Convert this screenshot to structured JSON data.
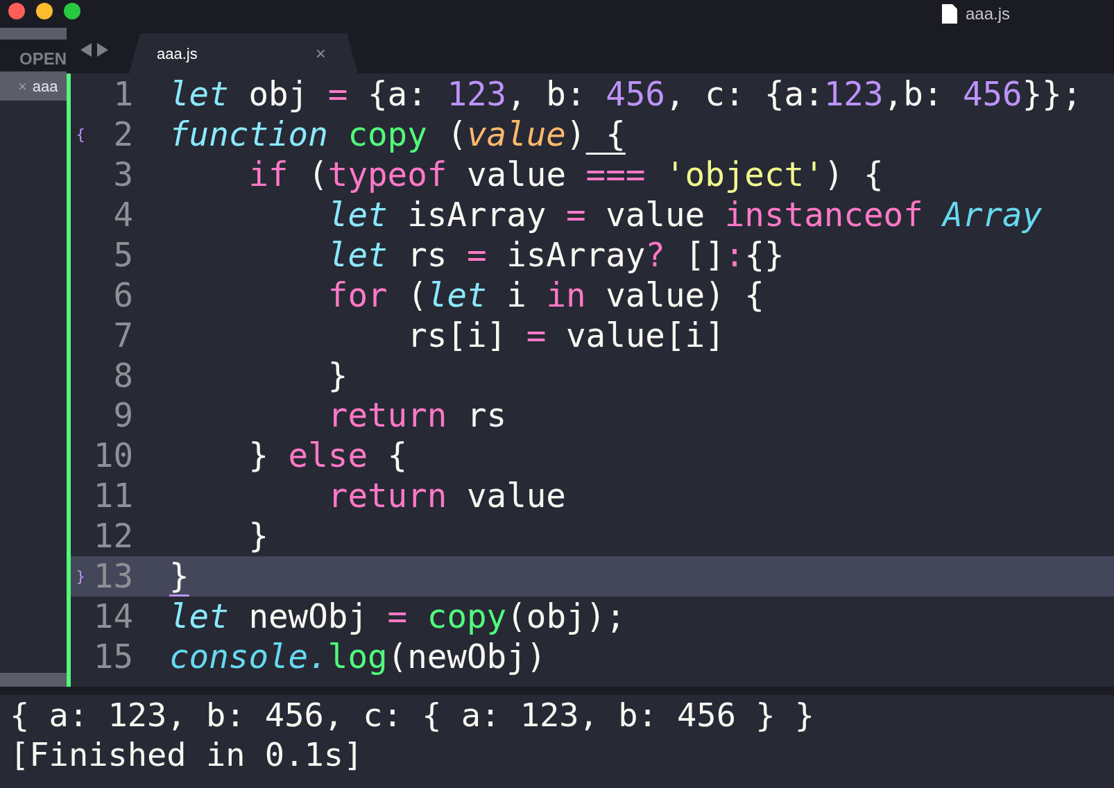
{
  "window": {
    "title": "aaa.js"
  },
  "sidebar": {
    "header": "OPEN",
    "items": [
      {
        "close_glyph": "×",
        "label": "aaa",
        "selected": true
      }
    ]
  },
  "tabs": [
    {
      "label": "aaa.js",
      "close_glyph": "×",
      "selected": true
    }
  ],
  "editor": {
    "lines": [
      {
        "number": "1",
        "current": false,
        "tokens": [
          {
            "t": "let",
            "kind": "storage"
          },
          {
            "t": " obj",
            "kind": "plain"
          },
          {
            "t": " =",
            "kind": "op"
          },
          {
            "t": " {a:",
            "kind": "plain"
          },
          {
            "t": " 123",
            "kind": "num"
          },
          {
            "t": ", b:",
            "kind": "plain"
          },
          {
            "t": " 456",
            "kind": "num"
          },
          {
            "t": ", c: {a:",
            "kind": "plain"
          },
          {
            "t": "123",
            "kind": "num"
          },
          {
            "t": ",b:",
            "kind": "plain"
          },
          {
            "t": " 456",
            "kind": "num"
          },
          {
            "t": "}};",
            "kind": "plain"
          }
        ]
      },
      {
        "number": "2",
        "fold": "{",
        "current": false,
        "tokens": [
          {
            "t": "function",
            "kind": "storage"
          },
          {
            "t": " copy",
            "kind": "fn"
          },
          {
            "t": " (",
            "kind": "plain"
          },
          {
            "t": "value",
            "kind": "param"
          },
          {
            "t": ")",
            "kind": "plain"
          },
          {
            "t": " {",
            "kind": "match"
          }
        ]
      },
      {
        "number": "3",
        "current": false,
        "tokens": [
          {
            "t": "    if",
            "kind": "kw"
          },
          {
            "t": " (",
            "kind": "plain"
          },
          {
            "t": "typeof",
            "kind": "kw"
          },
          {
            "t": " value",
            "kind": "plain"
          },
          {
            "t": " ===",
            "kind": "op"
          },
          {
            "t": " 'object'",
            "kind": "str"
          },
          {
            "t": ") {",
            "kind": "plain"
          }
        ]
      },
      {
        "number": "4",
        "current": false,
        "tokens": [
          {
            "t": "        let",
            "kind": "storage"
          },
          {
            "t": " isArray",
            "kind": "plain"
          },
          {
            "t": " =",
            "kind": "op"
          },
          {
            "t": " value",
            "kind": "plain"
          },
          {
            "t": " instanceof",
            "kind": "kw"
          },
          {
            "t": " Array",
            "kind": "class"
          }
        ]
      },
      {
        "number": "5",
        "current": false,
        "tokens": [
          {
            "t": "        let",
            "kind": "storage"
          },
          {
            "t": " rs",
            "kind": "plain"
          },
          {
            "t": " =",
            "kind": "op"
          },
          {
            "t": " isArray",
            "kind": "plain"
          },
          {
            "t": "?",
            "kind": "op"
          },
          {
            "t": " []",
            "kind": "plain"
          },
          {
            "t": ":",
            "kind": "op"
          },
          {
            "t": "{}",
            "kind": "plain"
          }
        ]
      },
      {
        "number": "6",
        "current": false,
        "tokens": [
          {
            "t": "        for",
            "kind": "kw"
          },
          {
            "t": " (",
            "kind": "plain"
          },
          {
            "t": "let",
            "kind": "storage"
          },
          {
            "t": " i",
            "kind": "plain"
          },
          {
            "t": " in",
            "kind": "kw"
          },
          {
            "t": " value) {",
            "kind": "plain"
          }
        ]
      },
      {
        "number": "7",
        "current": false,
        "tokens": [
          {
            "t": "            rs[i]",
            "kind": "plain"
          },
          {
            "t": " =",
            "kind": "op"
          },
          {
            "t": " value[i]",
            "kind": "plain"
          }
        ]
      },
      {
        "number": "8",
        "current": false,
        "tokens": [
          {
            "t": "        }",
            "kind": "plain"
          }
        ]
      },
      {
        "number": "9",
        "current": false,
        "tokens": [
          {
            "t": "        return",
            "kind": "kw"
          },
          {
            "t": " rs",
            "kind": "plain"
          }
        ]
      },
      {
        "number": "10",
        "current": false,
        "tokens": [
          {
            "t": "    }",
            "kind": "plain"
          },
          {
            "t": " else",
            "kind": "kw"
          },
          {
            "t": " {",
            "kind": "plain"
          }
        ]
      },
      {
        "number": "11",
        "current": false,
        "tokens": [
          {
            "t": "        return",
            "kind": "kw"
          },
          {
            "t": " value",
            "kind": "plain"
          }
        ]
      },
      {
        "number": "12",
        "current": false,
        "tokens": [
          {
            "t": "    }",
            "kind": "plain"
          }
        ]
      },
      {
        "number": "13",
        "fold": "}",
        "current": true,
        "tokens": [
          {
            "t": "}",
            "kind": "match"
          }
        ]
      },
      {
        "number": "14",
        "current": false,
        "tokens": [
          {
            "t": "let",
            "kind": "storage"
          },
          {
            "t": " newObj",
            "kind": "plain"
          },
          {
            "t": " =",
            "kind": "op"
          },
          {
            "t": " copy",
            "kind": "fn"
          },
          {
            "t": "(obj);",
            "kind": "plain"
          }
        ]
      },
      {
        "number": "15",
        "current": false,
        "tokens": [
          {
            "t": "console.",
            "kind": "class"
          },
          {
            "t": "log",
            "kind": "fn"
          },
          {
            "t": "(newObj)",
            "kind": "plain"
          }
        ]
      }
    ]
  },
  "output": {
    "lines": [
      "{ a: 123, b: 456, c: { a: 123, b: 456 } }",
      "[Finished in 0.1s]"
    ]
  }
}
